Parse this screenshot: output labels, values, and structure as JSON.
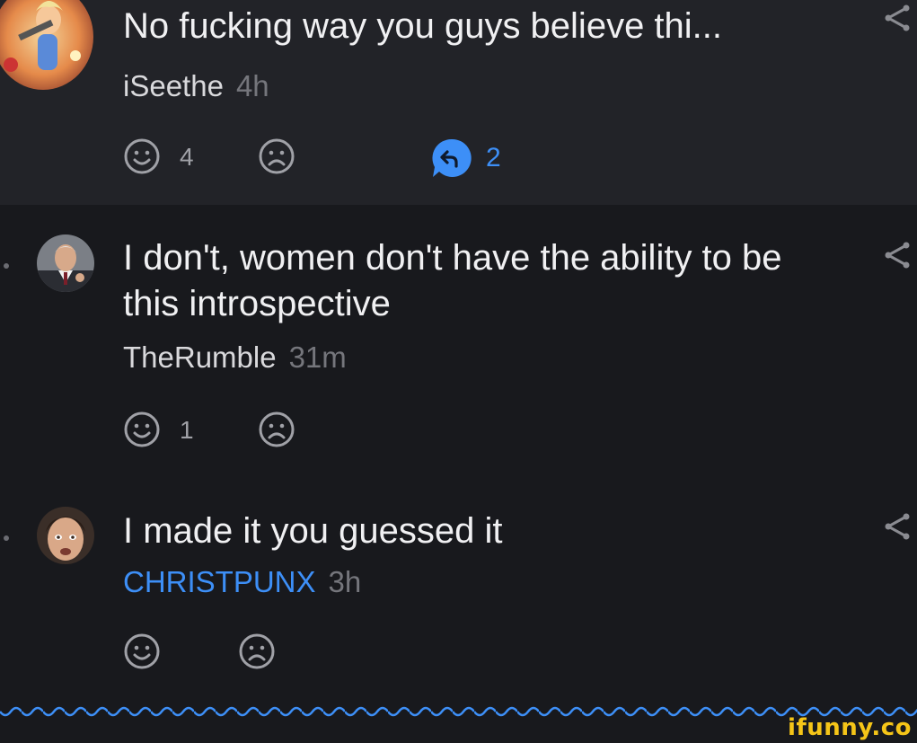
{
  "comments": [
    {
      "text": "No fucking way you guys believe thi...",
      "author": "iSeethe",
      "time": "4h",
      "smile_count": "4",
      "reply_count": "2"
    },
    {
      "text": "I don't, women don't have the ability to be this introspective",
      "author": "TheRumble",
      "time": "31m",
      "smile_count": "1"
    },
    {
      "text": "I made it you guessed it",
      "author": "CHRISTPUNX",
      "time": "3h"
    }
  ],
  "watermark": "ifunny.co",
  "colors": {
    "background": "#18191d",
    "highlight_row": "#222328",
    "accent_blue": "#3d8ff7",
    "icon_gray": "#a0a1a7",
    "watermark": "#f5c518"
  },
  "icons": [
    "smile-icon",
    "unsmile-icon",
    "reply-icon",
    "share-icon"
  ]
}
